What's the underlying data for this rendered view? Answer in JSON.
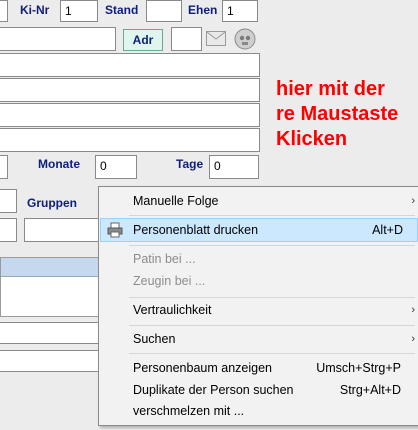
{
  "top_row": {
    "kinr_label": "Ki-Nr",
    "kinr_value": "1",
    "stand_label": "Stand",
    "stand_value": "",
    "ehen_label": "Ehen",
    "ehen_value": "1"
  },
  "adr_button": "Adr",
  "annotation": [
    "hier mit der",
    "re Maustaste",
    "Klicken"
  ],
  "monate_label": "Monate",
  "monate_value": "0",
  "tage_label": "Tage",
  "tage_value": "0",
  "gruppen_label": "Gruppen",
  "context_menu": {
    "items": [
      {
        "label": "Manuelle Folge",
        "shortcut": "",
        "submenu": true
      },
      {
        "label": "Personenblatt drucken",
        "shortcut": "Alt+D",
        "icon": "printer-icon"
      },
      {
        "label": "Patin bei ...",
        "disabled": true
      },
      {
        "label": "Zeugin bei ...",
        "disabled": true
      },
      {
        "label": "Vertraulichkeit",
        "submenu": true
      },
      {
        "label": "Suchen",
        "submenu": true
      },
      {
        "label": "Personenbaum anzeigen",
        "shortcut": "Umsch+Strg+P"
      },
      {
        "label": "Duplikate der Person suchen",
        "shortcut": "Strg+Alt+D"
      },
      {
        "label": "verschmelzen mit ..."
      }
    ]
  },
  "colors": {
    "accent_highlight": "#cce8ff",
    "label_color": "#10207a",
    "annotation_color": "#ff0000"
  }
}
